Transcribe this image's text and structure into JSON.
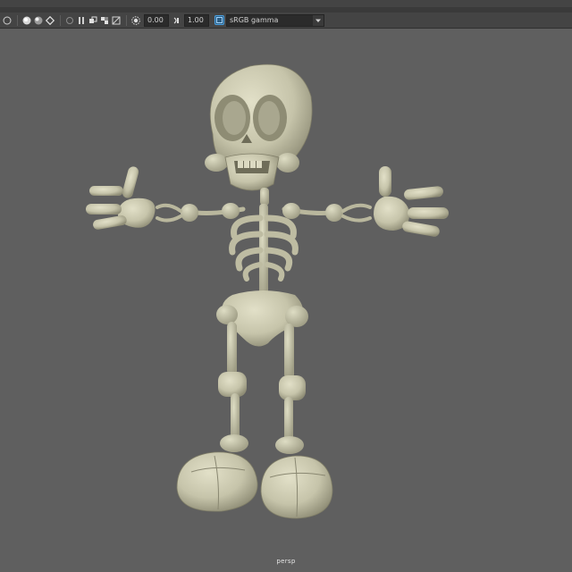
{
  "toolbar": {
    "exposure_value": "0.00",
    "gamma_value": "1.00",
    "colorspace_label": "sRGB gamma"
  },
  "viewport": {
    "camera_label": "persp"
  },
  "colors": {
    "viewport_bg": "#5f5f5f",
    "toolbar_bg": "#444444",
    "model_fill": "#c9c7ad",
    "model_shadow": "#8d8b74",
    "accent": "#4aa0e0"
  },
  "icons": [
    "wireframe-icon",
    "smooth-shade-icon",
    "lighting-icon",
    "shadows-icon",
    "isolate-icon",
    "xray-icon",
    "backface-icon",
    "texture-icon",
    "exposure-icon",
    "gamma-icon",
    "colorspace-icon"
  ]
}
